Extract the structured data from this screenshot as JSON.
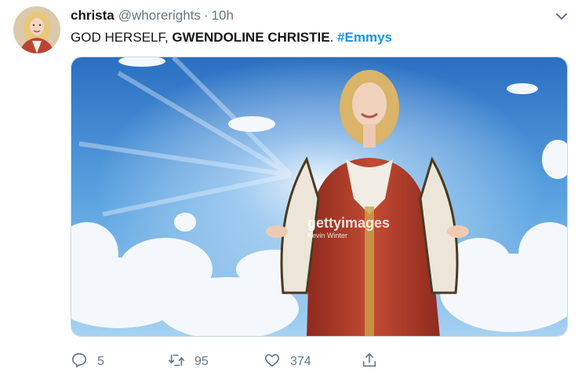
{
  "tweet": {
    "display_name": "christa",
    "handle": "@whorerights",
    "separator": "·",
    "time": "10h",
    "text_prefix": "GOD HERSELF, ",
    "text_bold": "GWENDOLINE CHRISTIE",
    "text_mid": ". ",
    "hashtag": "#Emmys",
    "media": {
      "watermark": "gettyimages",
      "credit": "Kevin Winter"
    },
    "actions": {
      "reply_count": "5",
      "retweet_count": "95",
      "like_count": "374"
    },
    "icons": {
      "caret": "chevron-down-icon",
      "reply": "reply-icon",
      "retweet": "retweet-icon",
      "like": "heart-icon",
      "share": "share-icon"
    },
    "colors": {
      "link": "#1b95e0",
      "secondary_text": "#657786",
      "primary_text": "#14171a"
    }
  }
}
